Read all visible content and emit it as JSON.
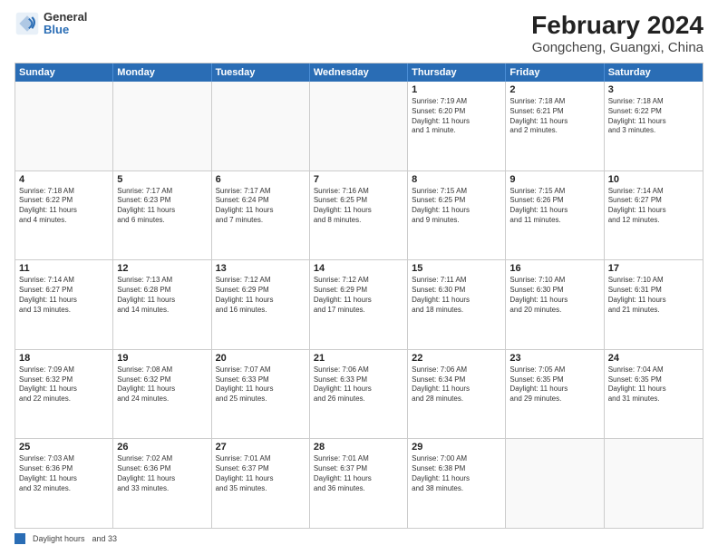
{
  "header": {
    "logo": {
      "line1": "General",
      "line2": "Blue"
    },
    "title": "February 2024",
    "subtitle": "Gongcheng, Guangxi, China"
  },
  "days_of_week": [
    "Sunday",
    "Monday",
    "Tuesday",
    "Wednesday",
    "Thursday",
    "Friday",
    "Saturday"
  ],
  "weeks": [
    [
      {
        "day": "",
        "info": ""
      },
      {
        "day": "",
        "info": ""
      },
      {
        "day": "",
        "info": ""
      },
      {
        "day": "",
        "info": ""
      },
      {
        "day": "1",
        "info": "Sunrise: 7:19 AM\nSunset: 6:20 PM\nDaylight: 11 hours\nand 1 minute."
      },
      {
        "day": "2",
        "info": "Sunrise: 7:18 AM\nSunset: 6:21 PM\nDaylight: 11 hours\nand 2 minutes."
      },
      {
        "day": "3",
        "info": "Sunrise: 7:18 AM\nSunset: 6:22 PM\nDaylight: 11 hours\nand 3 minutes."
      }
    ],
    [
      {
        "day": "4",
        "info": "Sunrise: 7:18 AM\nSunset: 6:22 PM\nDaylight: 11 hours\nand 4 minutes."
      },
      {
        "day": "5",
        "info": "Sunrise: 7:17 AM\nSunset: 6:23 PM\nDaylight: 11 hours\nand 6 minutes."
      },
      {
        "day": "6",
        "info": "Sunrise: 7:17 AM\nSunset: 6:24 PM\nDaylight: 11 hours\nand 7 minutes."
      },
      {
        "day": "7",
        "info": "Sunrise: 7:16 AM\nSunset: 6:25 PM\nDaylight: 11 hours\nand 8 minutes."
      },
      {
        "day": "8",
        "info": "Sunrise: 7:15 AM\nSunset: 6:25 PM\nDaylight: 11 hours\nand 9 minutes."
      },
      {
        "day": "9",
        "info": "Sunrise: 7:15 AM\nSunset: 6:26 PM\nDaylight: 11 hours\nand 11 minutes."
      },
      {
        "day": "10",
        "info": "Sunrise: 7:14 AM\nSunset: 6:27 PM\nDaylight: 11 hours\nand 12 minutes."
      }
    ],
    [
      {
        "day": "11",
        "info": "Sunrise: 7:14 AM\nSunset: 6:27 PM\nDaylight: 11 hours\nand 13 minutes."
      },
      {
        "day": "12",
        "info": "Sunrise: 7:13 AM\nSunset: 6:28 PM\nDaylight: 11 hours\nand 14 minutes."
      },
      {
        "day": "13",
        "info": "Sunrise: 7:12 AM\nSunset: 6:29 PM\nDaylight: 11 hours\nand 16 minutes."
      },
      {
        "day": "14",
        "info": "Sunrise: 7:12 AM\nSunset: 6:29 PM\nDaylight: 11 hours\nand 17 minutes."
      },
      {
        "day": "15",
        "info": "Sunrise: 7:11 AM\nSunset: 6:30 PM\nDaylight: 11 hours\nand 18 minutes."
      },
      {
        "day": "16",
        "info": "Sunrise: 7:10 AM\nSunset: 6:30 PM\nDaylight: 11 hours\nand 20 minutes."
      },
      {
        "day": "17",
        "info": "Sunrise: 7:10 AM\nSunset: 6:31 PM\nDaylight: 11 hours\nand 21 minutes."
      }
    ],
    [
      {
        "day": "18",
        "info": "Sunrise: 7:09 AM\nSunset: 6:32 PM\nDaylight: 11 hours\nand 22 minutes."
      },
      {
        "day": "19",
        "info": "Sunrise: 7:08 AM\nSunset: 6:32 PM\nDaylight: 11 hours\nand 24 minutes."
      },
      {
        "day": "20",
        "info": "Sunrise: 7:07 AM\nSunset: 6:33 PM\nDaylight: 11 hours\nand 25 minutes."
      },
      {
        "day": "21",
        "info": "Sunrise: 7:06 AM\nSunset: 6:33 PM\nDaylight: 11 hours\nand 26 minutes."
      },
      {
        "day": "22",
        "info": "Sunrise: 7:06 AM\nSunset: 6:34 PM\nDaylight: 11 hours\nand 28 minutes."
      },
      {
        "day": "23",
        "info": "Sunrise: 7:05 AM\nSunset: 6:35 PM\nDaylight: 11 hours\nand 29 minutes."
      },
      {
        "day": "24",
        "info": "Sunrise: 7:04 AM\nSunset: 6:35 PM\nDaylight: 11 hours\nand 31 minutes."
      }
    ],
    [
      {
        "day": "25",
        "info": "Sunrise: 7:03 AM\nSunset: 6:36 PM\nDaylight: 11 hours\nand 32 minutes."
      },
      {
        "day": "26",
        "info": "Sunrise: 7:02 AM\nSunset: 6:36 PM\nDaylight: 11 hours\nand 33 minutes."
      },
      {
        "day": "27",
        "info": "Sunrise: 7:01 AM\nSunset: 6:37 PM\nDaylight: 11 hours\nand 35 minutes."
      },
      {
        "day": "28",
        "info": "Sunrise: 7:01 AM\nSunset: 6:37 PM\nDaylight: 11 hours\nand 36 minutes."
      },
      {
        "day": "29",
        "info": "Sunrise: 7:00 AM\nSunset: 6:38 PM\nDaylight: 11 hours\nand 38 minutes."
      },
      {
        "day": "",
        "info": ""
      },
      {
        "day": "",
        "info": ""
      }
    ]
  ],
  "legend": {
    "label": "Daylight hours",
    "suffix": "and 33"
  }
}
